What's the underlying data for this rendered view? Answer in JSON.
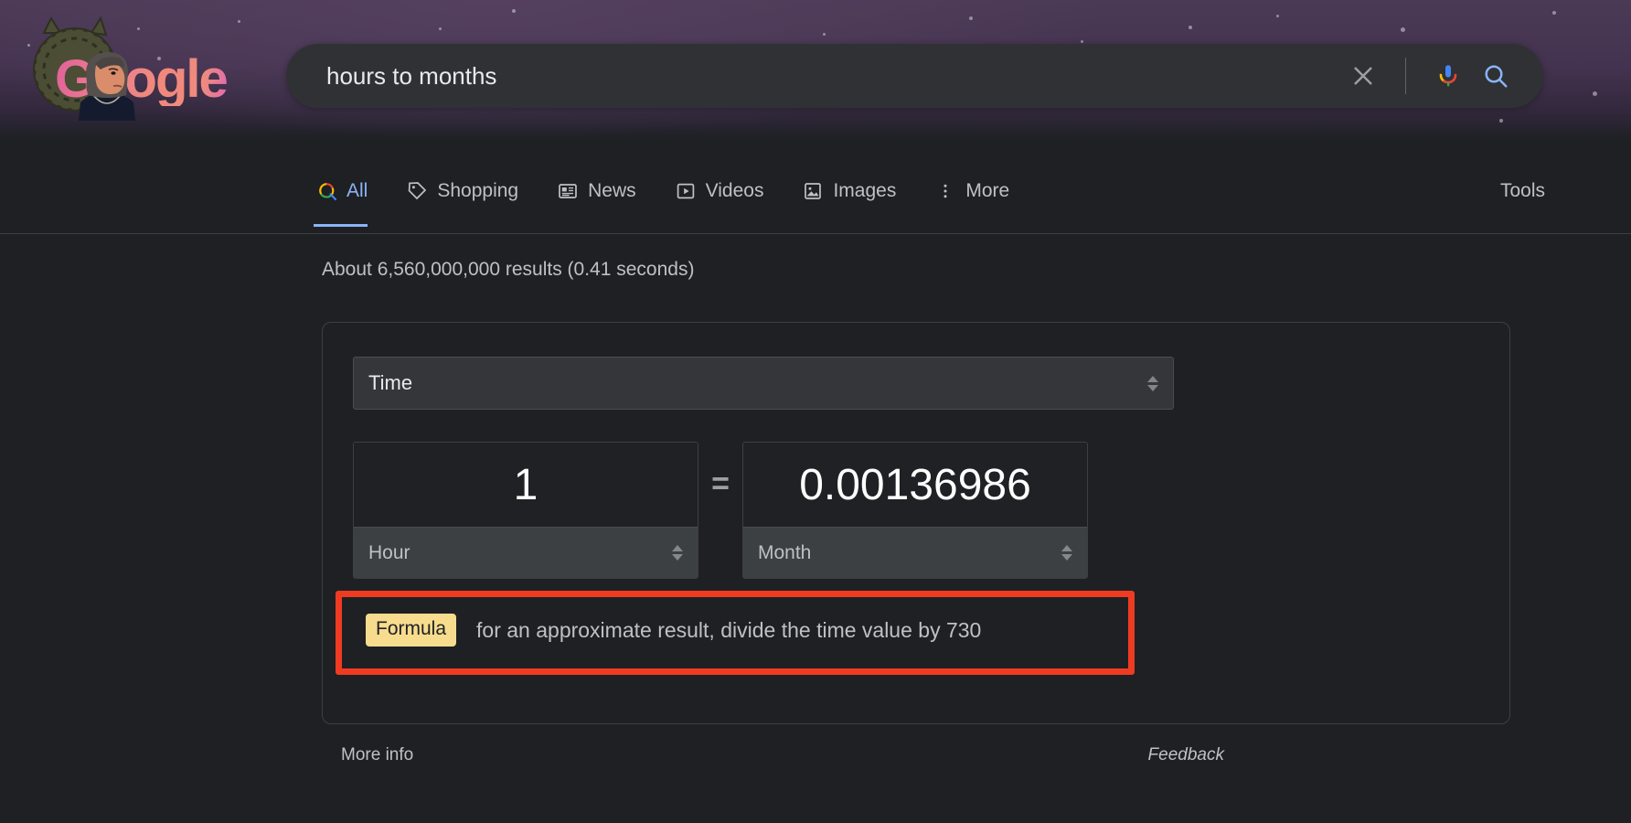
{
  "theme": {
    "page_bg": "#1f2023",
    "header_purple": "#4b3a56",
    "searchbar_bg": "#303134",
    "accent_blue": "#8ab4f8",
    "text_primary": "#e8eaed",
    "text_secondary": "#bdc1c6",
    "annotation_red": "#ef3b22",
    "badge_yellow": "#f7dc8e",
    "card_border": "#3c4043"
  },
  "doodle": {
    "wordmark": "Google",
    "alt": "google-doodle-logo",
    "headdress_color": "#4e5038",
    "wordmark_gradient_from": "#e0609a",
    "wordmark_gradient_to": "#e06ab0"
  },
  "search": {
    "value": "hours to months",
    "placeholder": "Search",
    "clear_icon": "close-icon",
    "voice_icon": "microphone-icon",
    "submit_icon": "search-icon"
  },
  "nav": {
    "tabs": [
      {
        "label": "All",
        "icon": "search-icon",
        "active": true
      },
      {
        "label": "Shopping",
        "icon": "tag-icon",
        "active": false
      },
      {
        "label": "News",
        "icon": "newspaper-icon",
        "active": false
      },
      {
        "label": "Videos",
        "icon": "play-box-icon",
        "active": false
      },
      {
        "label": "Images",
        "icon": "image-icon",
        "active": false
      },
      {
        "label": "More",
        "icon": "more-vertical-icon",
        "active": false
      }
    ],
    "tools_label": "Tools"
  },
  "result_stats": "About 6,560,000,000 results (0.41 seconds)",
  "converter": {
    "category": "Time",
    "category_stepper": "stepper-icon",
    "from": {
      "value": "1",
      "unit": "Hour",
      "stepper": "stepper-icon"
    },
    "operator": "=",
    "to": {
      "value": "0.00136986",
      "unit": "Month",
      "stepper": "stepper-icon"
    },
    "formula": {
      "badge": "Formula",
      "text": "for an approximate result, divide the time value by 730",
      "highlighted": true
    }
  },
  "footer": {
    "more_info": "More info",
    "feedback": "Feedback"
  }
}
